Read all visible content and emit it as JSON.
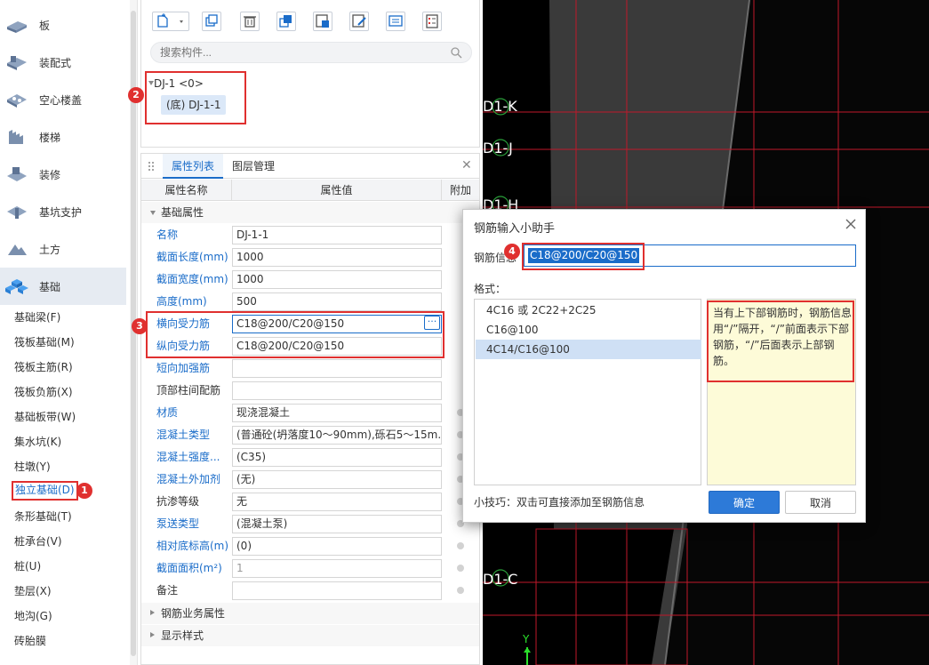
{
  "nav": {
    "categories": [
      {
        "label": "板",
        "icon": "slab-icon"
      },
      {
        "label": "装配式",
        "icon": "prefab-icon"
      },
      {
        "label": "空心楼盖",
        "icon": "hollow-floor-icon"
      },
      {
        "label": "楼梯",
        "icon": "stairs-icon"
      },
      {
        "label": "装修",
        "icon": "decoration-icon"
      },
      {
        "label": "基坑支护",
        "icon": "pit-support-icon"
      },
      {
        "label": "土方",
        "icon": "earthwork-icon"
      },
      {
        "label": "基础",
        "icon": "foundation-icon"
      }
    ],
    "sub_items": [
      "基础梁(F)",
      "筏板基础(M)",
      "筏板主筋(R)",
      "筏板负筋(X)",
      "基础板带(W)",
      "集水坑(K)",
      "柱墩(Y)",
      "独立基础(D)",
      "条形基础(T)",
      "桩承台(V)",
      "桩(U)",
      "垫层(X)",
      "地沟(G)",
      "砖胎膜"
    ]
  },
  "badges": [
    "1",
    "2",
    "3",
    "4"
  ],
  "component_panel": {
    "search_placeholder": "搜索构件...",
    "toolbar_icons": [
      "new-component-icon",
      "copy-icon",
      "delete-icon",
      "layer-copy-icon",
      "extract-icon",
      "batch-edit-icon",
      "display-icon",
      "list-icon"
    ],
    "tree_root": "DJ-1 <0>",
    "tree_child": "(底) DJ-1-1"
  },
  "property_panel": {
    "tabs": [
      "属性列表",
      "图层管理"
    ],
    "close": "✕",
    "headers": {
      "name": "属性名称",
      "value": "属性值",
      "extra": "附加"
    },
    "section_basic": "基础属性",
    "rows": [
      {
        "name": "名称",
        "value": "DJ-1-1"
      },
      {
        "name": "截面长度(mm)",
        "value": "1000"
      },
      {
        "name": "截面宽度(mm)",
        "value": "1000"
      },
      {
        "name": "高度(mm)",
        "value": "500"
      },
      {
        "name": "横向受力筋",
        "value": "C18@200/C20@150"
      },
      {
        "name": "纵向受力筋",
        "value": "C18@200/C20@150"
      },
      {
        "name": "短向加强筋",
        "value": ""
      },
      {
        "name": "顶部柱间配筋",
        "value": ""
      },
      {
        "name": "材质",
        "value": "现浇混凝土"
      },
      {
        "name": "混凝土类型",
        "value": "(普通砼(坍落度10～90mm),砾石5～15m..."
      },
      {
        "name": "混凝土强度...",
        "value": "(C35)"
      },
      {
        "name": "混凝土外加剂",
        "value": "(无)"
      },
      {
        "name": "抗渗等级",
        "value": "无"
      },
      {
        "name": "泵送类型",
        "value": "(混凝土泵)"
      },
      {
        "name": "相对底标高(m)",
        "value": "(0)"
      },
      {
        "name": "截面面积(m²)",
        "value": "1"
      },
      {
        "name": "备注",
        "value": ""
      }
    ],
    "ellipsis": "···",
    "section_rebar": "钢筋业务属性",
    "section_display": "显示样式"
  },
  "cad": {
    "axis_labels": [
      "D1-K",
      "D1-J",
      "D1-H",
      "D1-C"
    ],
    "y_axis": "Y"
  },
  "dialog": {
    "title": "钢筋输入小助手",
    "rebar_label": "钢筋信息",
    "rebar_value": "C18@200/C20@150",
    "format_label": "格式：",
    "formats": [
      "4C16 或 2C22+2C25",
      "C16@100",
      "4C14/C16@100"
    ],
    "hint": "当有上下部钢筋时，钢筋信息用“/”隔开，“/”前面表示下部钢筋，“/”后面表示上部钢筋。",
    "tip": "小技巧：双击可直接添加至钢筋信息",
    "ok": "确定",
    "cancel": "取消"
  },
  "colors": {
    "accent": "#1a6cc9",
    "annotation": "#e0302f",
    "canvas": "#000000",
    "grid_line": "#c0182a"
  }
}
